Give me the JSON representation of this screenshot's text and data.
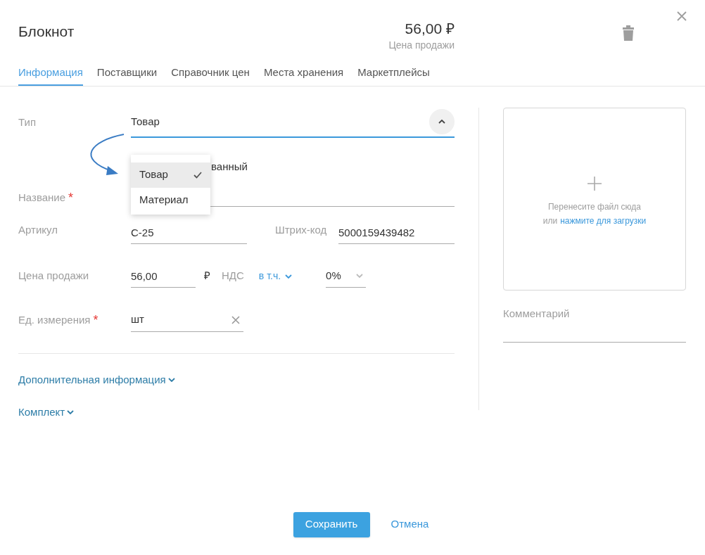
{
  "title": "Блокнот",
  "price": {
    "value": "56,00 ₽",
    "caption": "Цена продажи"
  },
  "tabs": [
    {
      "label": "Информация",
      "selected": true
    },
    {
      "label": "Поставщики",
      "selected": false
    },
    {
      "label": "Справочник цен",
      "selected": false
    },
    {
      "label": "Места хранения",
      "selected": false
    },
    {
      "label": "Маркетплейсы",
      "selected": false
    }
  ],
  "type_field": {
    "label": "Тип",
    "value": "Товар",
    "expanded": true,
    "options": [
      {
        "label": "Товар",
        "selected": true
      },
      {
        "label": "Материал",
        "selected": false
      }
    ]
  },
  "partly_hidden_text": "ванный",
  "required_mark": "*",
  "name_field": {
    "label": "Название",
    "required": true
  },
  "sku_field": {
    "label": "Артикул",
    "value": "С-25"
  },
  "barcode_field": {
    "label": "Штрих-код",
    "value": "5000159439482"
  },
  "price_field": {
    "label": "Цена продажи",
    "value": "56,00",
    "currency": "₽",
    "vat_label": "НДС",
    "vat_mode": "в т.ч.",
    "vat_rate": "0%"
  },
  "unit_field": {
    "label": "Ед. измерения",
    "required": true,
    "value": "шт"
  },
  "sections": [
    {
      "label": "Дополнительная информация",
      "expanded": false
    },
    {
      "label": "Комплект",
      "expanded": false
    }
  ],
  "upload": {
    "line1": "Перенесите файл сюда",
    "line2_prefix": "или",
    "line2_link": "нажмите для загрузки"
  },
  "comment": {
    "label": "Комментарий"
  },
  "buttons": {
    "save": "Сохранить",
    "cancel": "Отмена"
  }
}
